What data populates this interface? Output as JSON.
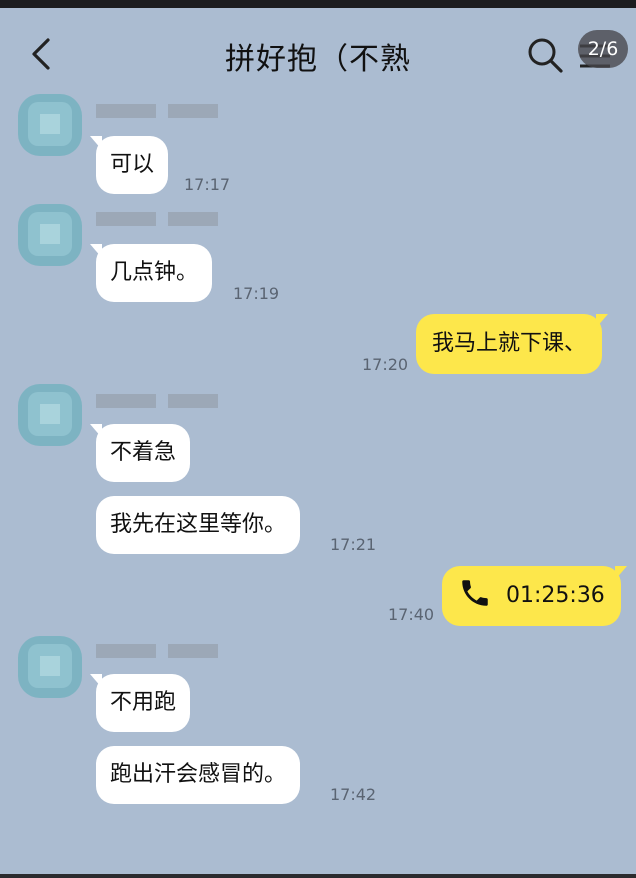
{
  "header": {
    "title": "拼好抱（不熟",
    "pager": "2/6"
  },
  "messages": [
    {
      "text": "可以",
      "time": "17:17"
    },
    {
      "text": "几点钟。",
      "time": "17:19"
    },
    {
      "text": "我马上就下课、",
      "time": "17:20"
    },
    {
      "text": "不着急"
    },
    {
      "text": "我先在这里等你。",
      "time": "17:21"
    },
    {
      "duration": "01:25:36",
      "time": "17:40"
    },
    {
      "text": "不用跑"
    },
    {
      "text": "跑出汗会感冒的。",
      "time": "17:42"
    }
  ],
  "colors": {
    "background": "#abbcd1",
    "incoming_bubble": "#ffffff",
    "outgoing_bubble": "#fde74b"
  }
}
